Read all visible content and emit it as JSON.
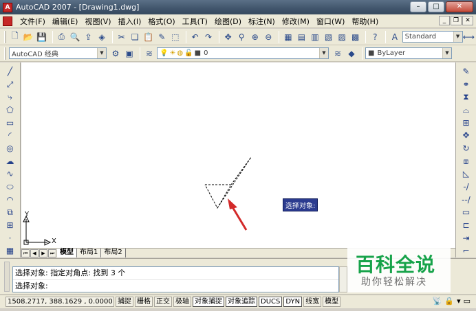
{
  "window": {
    "title": "AutoCAD 2007 - [Drawing1.dwg]",
    "app_glyph": "A"
  },
  "menubar": {
    "items": [
      "文件(F)",
      "编辑(E)",
      "视图(V)",
      "插入(I)",
      "格式(O)",
      "工具(T)",
      "绘图(D)",
      "标注(N)",
      "修改(M)",
      "窗口(W)",
      "帮助(H)"
    ]
  },
  "toolbar": {
    "text_style": "Standard",
    "workspace": "AutoCAD 经典",
    "layer": "0",
    "color": "ByLayer"
  },
  "canvas": {
    "ucs_x_label": "X",
    "ucs_y_label": "Y",
    "tooltip": "选择对象:"
  },
  "tabs": [
    "模型",
    "布局1",
    "布局2"
  ],
  "command": {
    "history": "选择对象: 指定对角点: 找到 3 个",
    "prompt": "选择对象:"
  },
  "watermark": {
    "title": "百科全说",
    "subtitle": "助你轻松解决"
  },
  "statusbar": {
    "coordinates": "1508.2717,  388.1629 , 0.0000",
    "buttons": [
      "捕捉",
      "栅格",
      "正交",
      "极轴",
      "对象捕捉",
      "对象追踪",
      "DUCS",
      "DYN",
      "线宽",
      "模型"
    ]
  },
  "icons": {
    "left_draw": [
      "line-icon",
      "construction-line-icon",
      "polyline-icon",
      "polygon-icon",
      "rectangle-icon",
      "arc-icon",
      "circle-icon",
      "revision-cloud-icon",
      "spline-icon",
      "ellipse-icon",
      "ellipse-arc-icon",
      "insert-block-icon",
      "make-block-icon",
      "point-icon",
      "hatch-icon"
    ],
    "right_modify": [
      "erase-icon",
      "copy-icon",
      "mirror-icon",
      "offset-icon",
      "array-icon",
      "move-icon",
      "rotate-icon",
      "scale-icon",
      "stretch-icon",
      "trim-icon",
      "extend-icon",
      "break-at-point-icon",
      "break-icon",
      "join-icon",
      "chamfer-icon"
    ]
  }
}
